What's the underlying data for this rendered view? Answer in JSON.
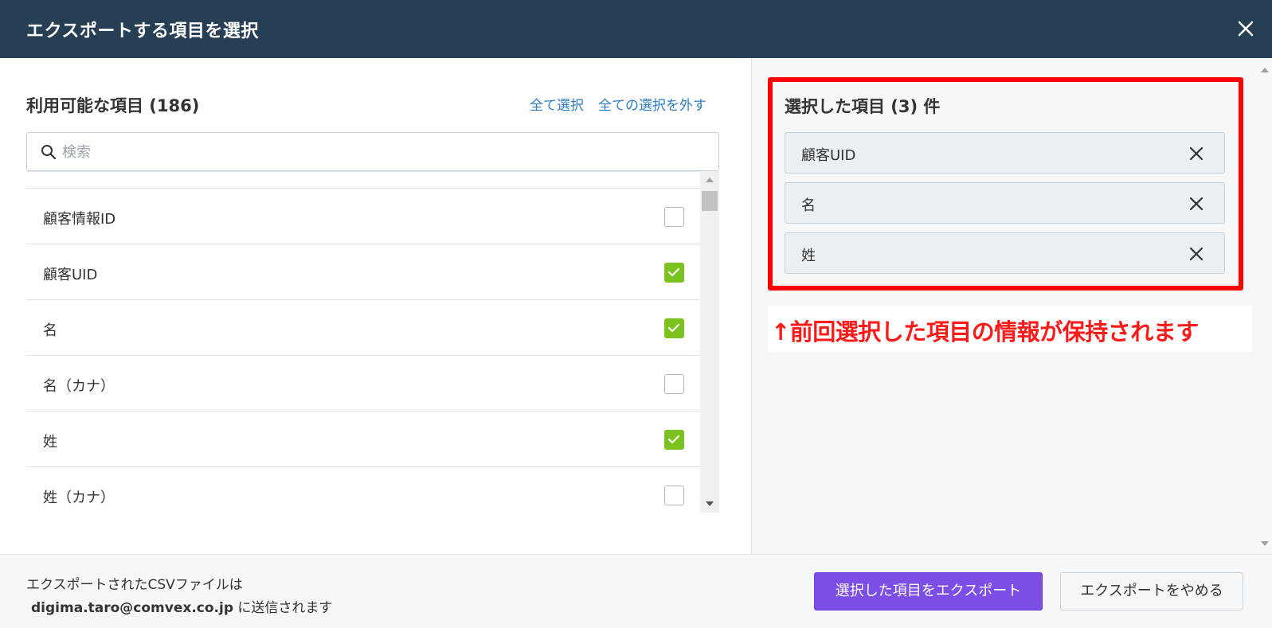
{
  "dialog": {
    "title": "エクスポートする項目を選択",
    "close_icon": "close-icon"
  },
  "available": {
    "title": "利用可能な項目 (186)",
    "select_all": "全て選択",
    "deselect_all": "全ての選択を外す",
    "search_placeholder": "検索",
    "search_value": "",
    "items": [
      {
        "label": "顧客情報ID",
        "checked": false
      },
      {
        "label": "顧客UID",
        "checked": true
      },
      {
        "label": "名",
        "checked": true
      },
      {
        "label": "名（カナ）",
        "checked": false
      },
      {
        "label": "姓",
        "checked": true
      },
      {
        "label": "姓（カナ）",
        "checked": false
      }
    ]
  },
  "selected": {
    "title": "選択した項目 (3) 件",
    "items": [
      {
        "label": "顧客UID"
      },
      {
        "label": "名"
      },
      {
        "label": "姓"
      }
    ]
  },
  "annotation": {
    "text": "↑前回選択した項目の情報が保持されます",
    "color": "#ff1a1a"
  },
  "footer": {
    "line1": "エクスポートされたCSVファイルは",
    "email": "digima.taro@comvex.co.jp",
    "line2_suffix": " に送信されます",
    "export_button": "選択した項目をエクスポート",
    "cancel_button": "エクスポートをやめる"
  },
  "colors": {
    "header_bg": "#263f55",
    "accent_purple": "#7d4ee6",
    "check_green": "#7cc21f",
    "link_blue": "#2f7dc5",
    "highlight_red": "#ff0000"
  }
}
